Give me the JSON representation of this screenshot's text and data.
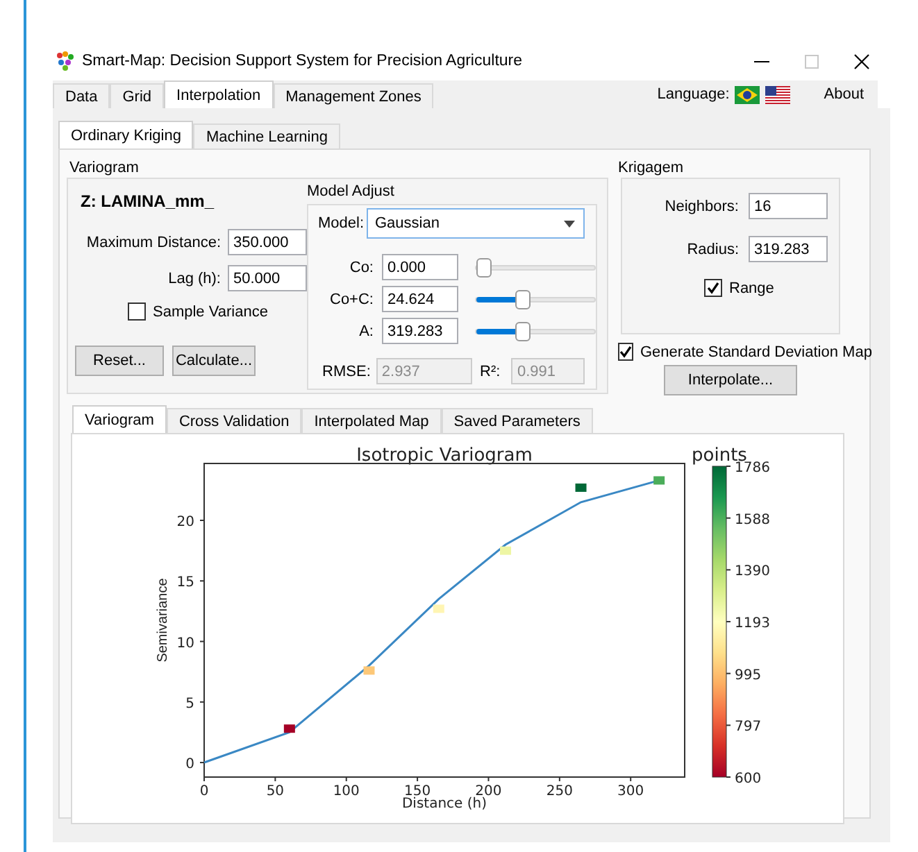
{
  "window": {
    "title": "Smart-Map: Decision Support System for Precision Agriculture"
  },
  "menu_tabs": [
    {
      "label": "Data",
      "selected": false
    },
    {
      "label": "Grid",
      "selected": false
    },
    {
      "label": "Interpolation",
      "selected": true
    },
    {
      "label": "Management Zones",
      "selected": false
    }
  ],
  "language_label": "Language:",
  "about": "About",
  "method_tabs": [
    {
      "label": "Ordinary Kriging",
      "selected": true
    },
    {
      "label": "Machine Learning",
      "selected": false
    }
  ],
  "variogram": {
    "title": "Variogram",
    "variable": "Z: LAMINA_mm_",
    "fields": [
      {
        "label": "Maximum Distance:",
        "value": "350.000"
      },
      {
        "label": "Lag (h):",
        "value": "50.000"
      }
    ],
    "sample_variance": {
      "label": "Sample Variance",
      "checked": false
    },
    "buttons": [
      "Reset...",
      "Calculate..."
    ]
  },
  "model_adjust": {
    "title": "Model Adjust",
    "model_label": "Model:",
    "model": "Gaussian",
    "params": [
      {
        "label": "Co:",
        "value": "0.000",
        "level": 0
      },
      {
        "label": "Co+C:",
        "value": "24.624",
        "level": 0.38
      },
      {
        "label": "A:",
        "value": "319.283",
        "level": 0.38
      }
    ],
    "rmse": {
      "label": "RMSE:",
      "value": "2.937",
      "disabled": true
    },
    "r2": {
      "label": "R²:",
      "value": "0.991",
      "disabled": true
    }
  },
  "krigagem": {
    "title": "Krigagem",
    "fields": [
      {
        "label": "Neighbors:",
        "value": "16"
      },
      {
        "label": "Radius:",
        "value": "319.283"
      }
    ],
    "range": {
      "label": "Range",
      "checked": true
    }
  },
  "std_map": {
    "label": "Generate Standard Deviation Map",
    "checked": true
  },
  "interpolate_button": "Interpolate...",
  "result_tabs": [
    {
      "label": "Variogram",
      "selected": true
    },
    {
      "label": "Cross Validation",
      "selected": false
    },
    {
      "label": "Interpolated Map",
      "selected": false
    },
    {
      "label": "Saved Parameters",
      "selected": false
    }
  ],
  "chart": {
    "chart_data": {
      "type": "line",
      "title": "Isotropic Variogram",
      "xlabel": "Distance (h)",
      "ylabel": "Semivariance",
      "x": [
        0,
        60,
        116,
        165,
        212,
        265,
        320
      ],
      "series": [
        {
          "color": "#3a88c4",
          "values": [
            0,
            2.5,
            8,
            13.5,
            18,
            21.5,
            23.3
          ]
        }
      ],
      "xlim": [
        0,
        338
      ],
      "ylim": [
        -1.2,
        24.7
      ],
      "xticks": [
        0,
        50,
        100,
        150,
        200,
        250,
        300
      ],
      "yticks": [
        0,
        5,
        10,
        15,
        20
      ]
    },
    "points_chart": {
      "chart_data": {
        "type": "scatter",
        "x": [
          60,
          116,
          165,
          212,
          265,
          320
        ],
        "xlim": [
          0,
          338
        ],
        "ylim": [
          -1.2,
          24.7
        ],
        "series": [
          {
            "color": "#a50026",
            "values": [
              2.8,
              null,
              null,
              null,
              null,
              null
            ]
          },
          {
            "color": "#fdc878",
            "values": [
              null,
              7.6,
              null,
              null,
              null,
              null
            ]
          },
          {
            "color": "#fff5b3",
            "values": [
              null,
              null,
              12.7,
              null,
              null,
              null
            ]
          },
          {
            "color": "#eef6a4",
            "values": [
              null,
              null,
              null,
              17.5,
              null,
              null
            ]
          },
          {
            "color": "#006837",
            "values": [
              null,
              null,
              null,
              null,
              22.7,
              null
            ]
          },
          {
            "color": "#4bad5a",
            "values": [
              null,
              null,
              null,
              null,
              null,
              23.3
            ]
          }
        ]
      }
    },
    "colorbar": {
      "title": "points",
      "ticks": [
        "1786",
        "1588",
        "1390",
        "1193",
        "995",
        "797",
        "600"
      ]
    }
  }
}
